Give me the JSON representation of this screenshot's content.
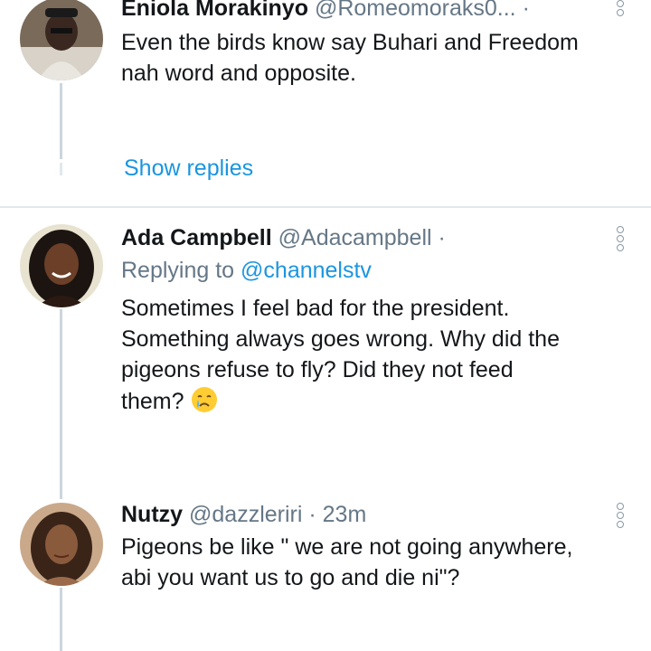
{
  "tweets": [
    {
      "name": "Eniola Morakinyo",
      "handle": "@Romeomoraks0...",
      "separator": "·",
      "text_line1": "Even the birds know say Buhari and Freedom",
      "text_line2": "nah word and opposite.",
      "show_replies": "Show replies"
    },
    {
      "name": "Ada Campbell",
      "handle": "@Adacampbell",
      "separator": "·",
      "replying_prefix": "Replying to",
      "replying_mention": "@channelstv",
      "text_line1": "Sometimes I feel bad for the president.",
      "text_line2": "Something always goes wrong. Why did the",
      "text_line3": "pigeons refuse to fly? Did they not feed",
      "text_line4": "them?",
      "emoji": "crying-face"
    },
    {
      "name": "Nutzy",
      "handle": "@dazzleriri",
      "separator": "·",
      "time": "23m",
      "text_line1": "Pigeons be like \" we are not going anywhere,",
      "text_line2": "abi you want us to go and die ni\"?"
    }
  ],
  "colors": {
    "link": "#1b95e0",
    "secondary_text": "#657786",
    "divider": "#e1e8ed",
    "thread_line": "#ccd6dd"
  }
}
